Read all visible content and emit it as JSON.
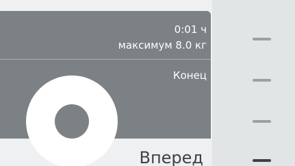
{
  "program": {
    "time": "0:01 ч",
    "max_load": "максимум 8.0 кг",
    "status": "Конец",
    "action": "Вперед"
  },
  "sidebar": {
    "levels": 4,
    "active_level": 4
  },
  "colors": {
    "panel": "#7b8184",
    "background": "#eef0f1",
    "sidebar": "#e2e5e6",
    "active_indicator": "#3c4245",
    "inactive_indicator": "#9aa0a3"
  }
}
